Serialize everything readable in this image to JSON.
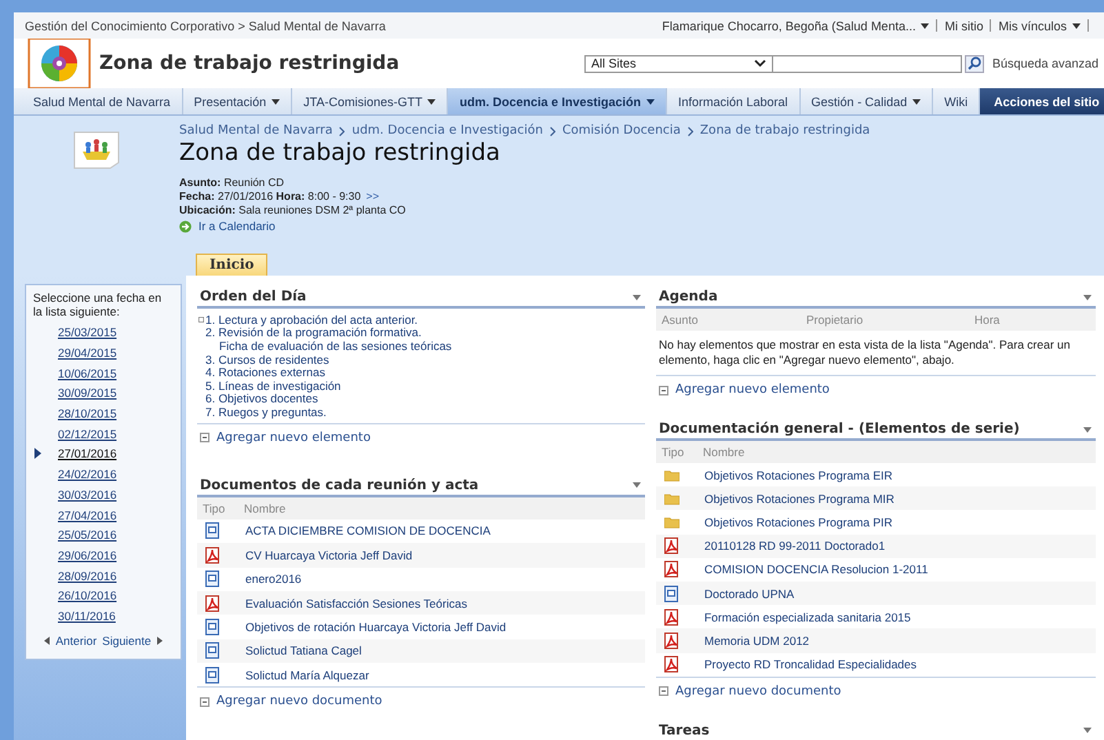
{
  "top_bar": {
    "breadcrumb": "Gestión del Conocimiento Corporativo > Salud Mental de Navarra",
    "user": "Flamarique Chocarro, Begoña (Salud Menta...",
    "links": [
      "Mi sitio",
      "Mis vínculos"
    ]
  },
  "header": {
    "site_title": "Zona de trabajo restringida",
    "scope": "All Sites",
    "advanced_search": "Búsqueda avanzad"
  },
  "nav": {
    "tabs": [
      {
        "label": "Salud Mental de Navarra",
        "dropdown": false,
        "selected": false
      },
      {
        "label": "Presentación",
        "dropdown": true,
        "selected": false
      },
      {
        "label": "JTA-Comisiones-GTT",
        "dropdown": true,
        "selected": false
      },
      {
        "label": "udm. Docencia e Investigación",
        "dropdown": true,
        "selected": true
      },
      {
        "label": "Información Laboral",
        "dropdown": false,
        "selected": false
      },
      {
        "label": "Gestión - Calidad",
        "dropdown": true,
        "selected": false
      },
      {
        "label": "Wiki",
        "dropdown": false,
        "selected": false
      }
    ],
    "site_actions": "Acciones del sitio"
  },
  "page": {
    "breadcrumb": [
      "Salud Mental de Navarra",
      "udm. Docencia e Investigación",
      "Comisión Docencia",
      "Zona de trabajo restringida"
    ],
    "title": "Zona de trabajo restringida",
    "meeting": {
      "subject": "**Asunto:** Reunión CD",
      "date_time": "**Fecha:** 27/01/2016 **Hora:** 8:00 - 9:30",
      "more": ">>",
      "location": "**Ubicación:** Sala reuniones DSM 2ª planta CO"
    },
    "calendar_link": "Ir a Calendario",
    "tabs": [
      {
        "label": "Inicio",
        "selected": true
      }
    ]
  },
  "date_picker": {
    "prompt": "Seleccione una fecha en la lista siguiente:",
    "dates": [
      {
        "label": "25/03/2015",
        "selected": false
      },
      {
        "label": "29/04/2015",
        "selected": false
      },
      {
        "label": "10/06/2015",
        "selected": false
      },
      {
        "label": "30/09/2015",
        "selected": false
      },
      {
        "label": "28/10/2015",
        "selected": false
      },
      {
        "label": "02/12/2015",
        "selected": false
      },
      {
        "label": "27/01/2016",
        "selected": true
      },
      {
        "label": "24/02/2016",
        "selected": false
      },
      {
        "label": "30/03/2016",
        "selected": false
      },
      {
        "label": "27/04/2016",
        "selected": false
      },
      {
        "label": "25/05/2016",
        "selected": false
      },
      {
        "label": "29/06/2016",
        "selected": false
      },
      {
        "label": "28/09/2016",
        "selected": false
      },
      {
        "label": "26/10/2016",
        "selected": false
      },
      {
        "label": "30/11/2016",
        "selected": false
      }
    ],
    "previous": "Anterior",
    "next": "Siguiente"
  },
  "agenda_of_day": {
    "title": "Orden del Día",
    "items": [
      {
        "kind": "item",
        "text": "1. Lectura y aprobación del acta anterior."
      },
      {
        "kind": "item",
        "text": "2. Revisión de la programación formativa."
      },
      {
        "kind": "sub",
        "text": "Ficha de evaluación de las sesiones teóricas"
      },
      {
        "kind": "item",
        "text": "3. Cursos de residentes"
      },
      {
        "kind": "item",
        "text": "4. Rotaciones externas"
      },
      {
        "kind": "item",
        "text": "5. Líneas de investigación"
      },
      {
        "kind": "item",
        "text": "6. Objetivos docentes"
      },
      {
        "kind": "item",
        "text": "7. Ruegos y preguntas."
      }
    ],
    "add_link": "Agregar nuevo elemento"
  },
  "meeting_documents": {
    "title": "Documentos de cada reunión y acta",
    "columns": [
      "Tipo",
      "Nombre"
    ],
    "rows": [
      {
        "kind": "word",
        "name": "ACTA DICIEMBRE COMISION DE DOCENCIA"
      },
      {
        "kind": "pdf",
        "name": "CV Huarcaya Victoria Jeff David"
      },
      {
        "kind": "word",
        "name": "enero2016"
      },
      {
        "kind": "pdf",
        "name": "Evaluación Satisfacción Sesiones Teóricas"
      },
      {
        "kind": "word",
        "name": "Objetivos de rotación Huarcaya Victoria Jeff David"
      },
      {
        "kind": "word",
        "name": "Solictud Tatiana Cagel"
      },
      {
        "kind": "word",
        "name": "Solictud María Alquezar"
      }
    ],
    "add_link": "Agregar nuevo documento"
  },
  "agenda": {
    "title": "Agenda",
    "columns": [
      "Asunto",
      "Propietario",
      "Hora"
    ],
    "empty_message": "No hay elementos que mostrar en esta vista de la lista \"Agenda\". Para crear un elemento, haga clic en \"Agregar nuevo elemento\", abajo.",
    "add_link": "Agregar nuevo elemento"
  },
  "general_documents": {
    "title": "Documentación general - (Elementos de serie)",
    "columns": [
      "Tipo",
      "Nombre"
    ],
    "rows": [
      {
        "kind": "folder",
        "name": "Objetivos Rotaciones Programa EIR"
      },
      {
        "kind": "folder",
        "name": "Objetivos Rotaciones Programa MIR"
      },
      {
        "kind": "folder",
        "name": "Objetivos Rotaciones Programa PIR"
      },
      {
        "kind": "pdf",
        "name": "20110128 RD 99-2011 Doctorado1"
      },
      {
        "kind": "pdf",
        "name": "COMISION DOCENCIA Resolucion 1-2011"
      },
      {
        "kind": "word",
        "name": "Doctorado UPNA"
      },
      {
        "kind": "pdf",
        "name": "Formación especializada sanitaria 2015"
      },
      {
        "kind": "pdf",
        "name": "Memoria UDM 2012"
      },
      {
        "kind": "pdf",
        "name": "Proyecto RD Troncalidad Especialidades"
      }
    ],
    "add_link": "Agregar nuevo documento"
  },
  "tasks": {
    "title": "Tareas"
  }
}
